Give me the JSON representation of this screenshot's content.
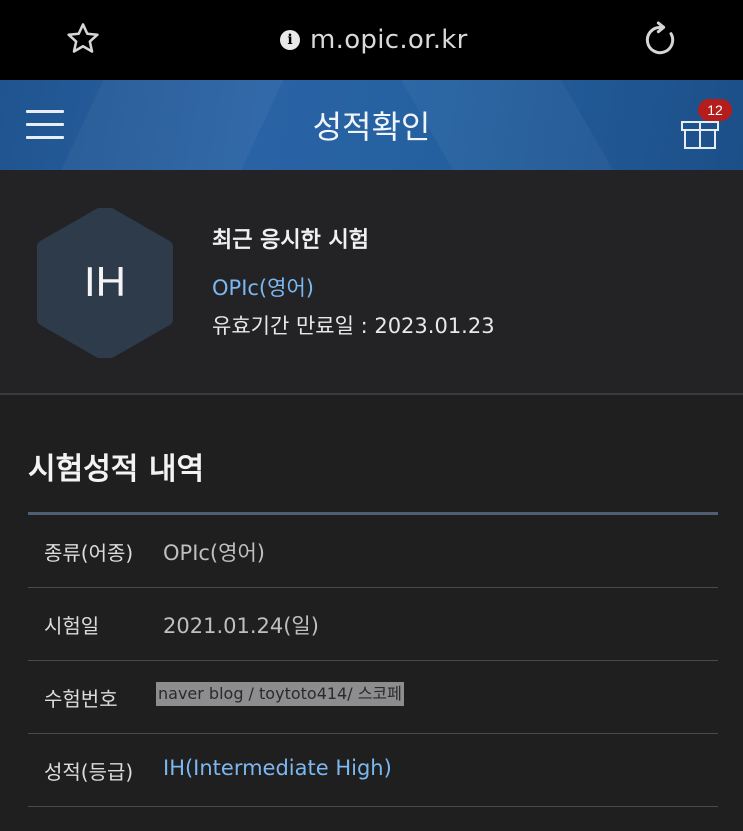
{
  "browser": {
    "url": "m.opic.or.kr",
    "info_icon": "i"
  },
  "header": {
    "title": "성적확인",
    "badge_count": "12",
    "colors": {
      "primary": "#2a63a5",
      "badge": "#b51d1d"
    }
  },
  "summary": {
    "grade": "IH",
    "recent_label": "최근 응시한 시험",
    "exam_name": "OPIc(영어)",
    "expiry": "유효기간 만료일 : 2023.01.23"
  },
  "results": {
    "title": "시험성적 내역",
    "rows": [
      {
        "label": "종류(어종)",
        "value": "OPIc(영어)"
      },
      {
        "label": "시험일",
        "value": "2021.01.24(일)"
      },
      {
        "label": "수험번호",
        "value": "naver blog / toytoto414/ 스코페"
      },
      {
        "label": "성적(등급)",
        "value": "IH(Intermediate High)"
      }
    ]
  }
}
